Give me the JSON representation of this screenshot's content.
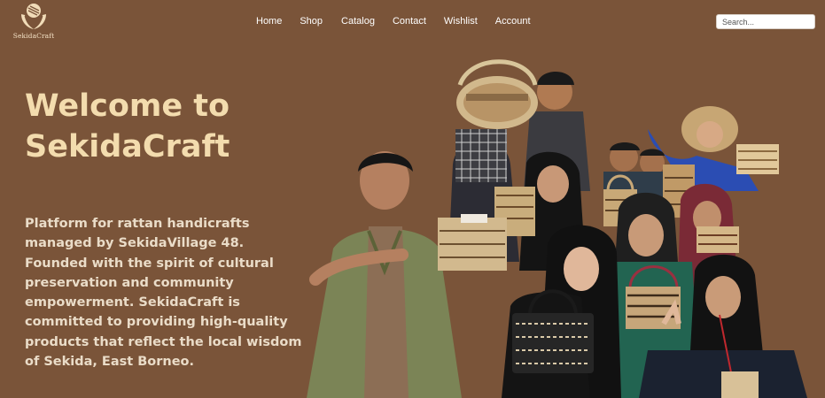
{
  "brand": {
    "name": "SekidaCraft",
    "logo_icon": "rattan-hands-logo-icon"
  },
  "nav": {
    "items": [
      {
        "label": "Home"
      },
      {
        "label": "Shop"
      },
      {
        "label": "Catalog"
      },
      {
        "label": "Contact"
      },
      {
        "label": "Wishlist"
      },
      {
        "label": "Account"
      }
    ]
  },
  "search": {
    "placeholder": "Search..."
  },
  "hero": {
    "title_line1": "Welcome to",
    "title_line2": "SekidaCraft",
    "description": "Platform for rattan handicrafts managed by SekidaVillage 48. Founded with the spirit of cultural preservation and community empowerment. SekidaCraft is committed to providing high-quality products that reflect the local wisdom of Sekida, East Borneo."
  },
  "colors": {
    "background": "#7a5439",
    "title": "#f3dcae",
    "text": "#eadcc8",
    "nav_text": "#ffffff"
  }
}
